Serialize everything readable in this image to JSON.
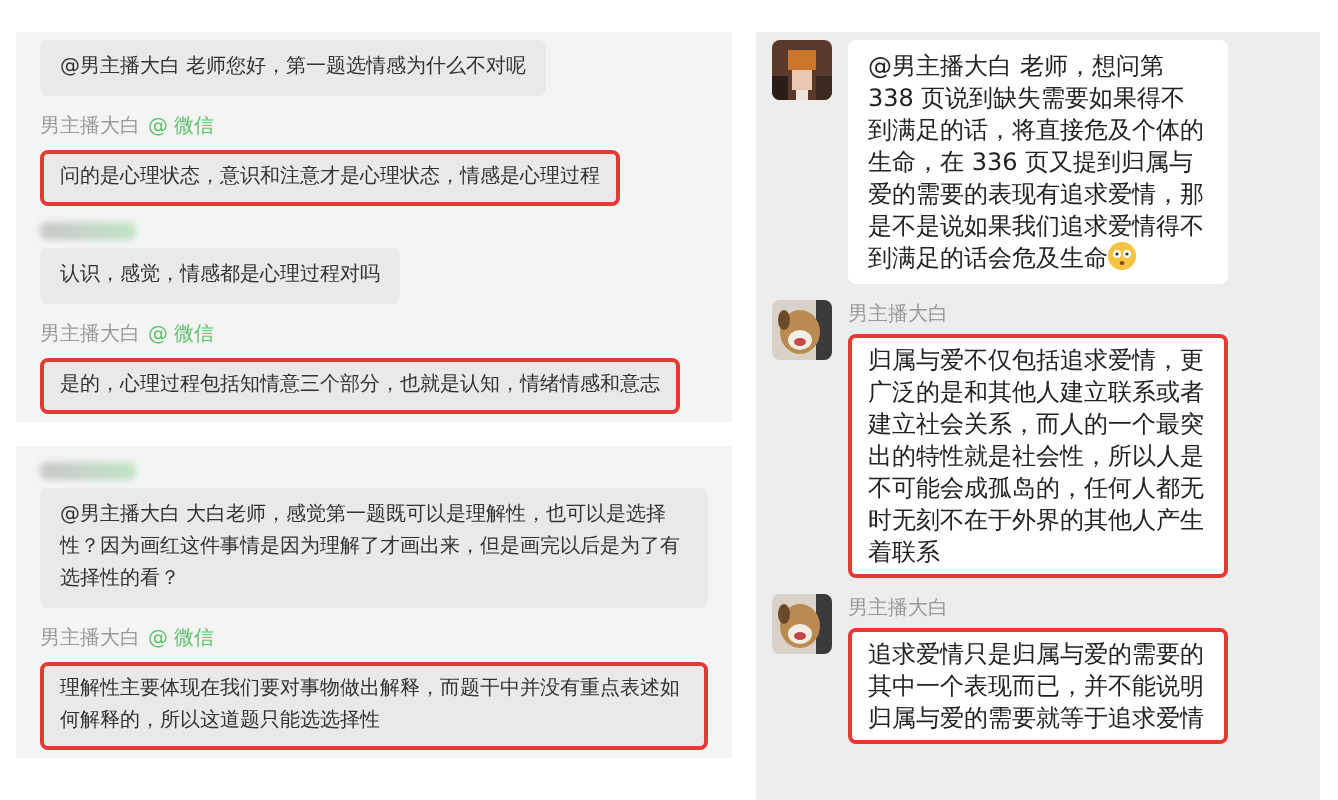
{
  "left_panels": [
    {
      "messages": [
        {
          "text": "@男主播大白 老师您好，第一题选情感为什么不对呢",
          "highlighted": false
        },
        {
          "sender": "男主播大白",
          "source": "@ 微信",
          "text": "问的是心理状态，意识和注意才是心理状态，情感是心理过程",
          "highlighted": true
        },
        {
          "sender_blurred": true,
          "text": "认识，感觉，情感都是心理过程对吗",
          "highlighted": false
        },
        {
          "sender": "男主播大白",
          "source": "@ 微信",
          "text": "是的，心理过程包括知情意三个部分，也就是认知，情绪情感和意志",
          "highlighted": true
        }
      ]
    },
    {
      "messages": [
        {
          "sender_blurred": true,
          "text": "@男主播大白 大白老师，感觉第一题既可以是理解性，也可以是选择性？因为画红这件事情是因为理解了才画出来，但是画完以后是为了有选择性的看？",
          "highlighted": false
        },
        {
          "sender": "男主播大白",
          "source": "@ 微信",
          "text": "理解性主要体现在我们要对事物做出解释，而题干中并没有重点表述如何解释的，所以这道题只能选选择性",
          "highlighted": true
        }
      ]
    }
  ],
  "right_panel": {
    "messages": [
      {
        "text": "@男主播大白 老师，想问第 338 页说到缺失需要如果得不到满足的话，将直接危及个体的生命，在 336 页又提到归属与爱的需要的表现有追求爱情，那是不是说如果我们追求爱情得不到满足的话会危及生命",
        "emoji": true,
        "highlighted": false
      },
      {
        "sender": "男主播大白",
        "text": "归属与爱不仅包括追求爱情，更广泛的是和其他人建立联系或者建立社会关系，而人的一个最突出的特性就是社会性，所以人是不可能会成孤岛的，任何人都无时无刻不在于外界的其他人产生着联系",
        "emoji": false,
        "highlighted": true
      },
      {
        "sender": "男主播大白",
        "text": "追求爱情只是归属与爱的需要的其中一个表现而已，并不能说明归属与爱的需要就等于追求爱情",
        "emoji": false,
        "highlighted": true
      }
    ]
  }
}
